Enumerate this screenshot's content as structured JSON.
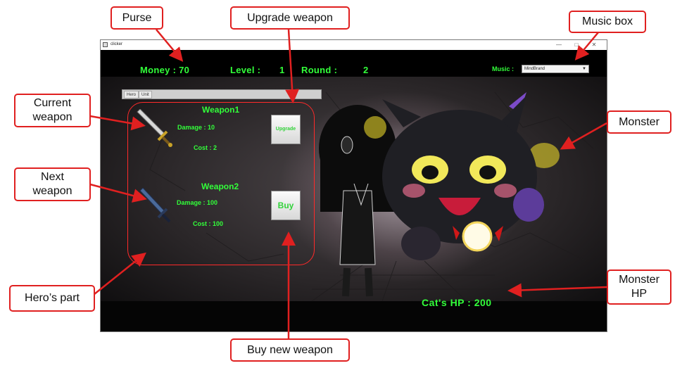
{
  "window": {
    "title": "clicker",
    "controls": {
      "minimize": "—",
      "maximize": "□",
      "close": "✕"
    }
  },
  "hud": {
    "money": "Money : 70",
    "level_label": "Level :",
    "level_value": "1",
    "round_label": "Round :",
    "round_value": "2",
    "music_label": "Music :",
    "music_selected": "MindBrand"
  },
  "tabs": [
    "Hero",
    "Unit"
  ],
  "weapons": {
    "current": {
      "name": "Weapon1",
      "damage": "Damage : 10",
      "cost": "Cost : 2",
      "button": "Upgrade"
    },
    "next": {
      "name": "Weapon2",
      "damage": "Damage : 100",
      "cost": "Cost : 100",
      "button": "Buy"
    }
  },
  "monster": {
    "hp_text": "Cat's  HP  :  200"
  },
  "annotations": {
    "purse": "Purse",
    "upgrade_weapon": "Upgrade weapon",
    "music_box": "Music box",
    "current_weapon": "Current\nweapon",
    "monster": "Monster",
    "next_weapon": "Next\nweapon",
    "monster_hp": "Monster\nHP",
    "heros_part": "Hero’s part",
    "buy_new_weapon": "Buy new weapon"
  },
  "icons": [
    "sword-icon",
    "dark-sword-icon",
    "cat-monster",
    "gothic-girl"
  ],
  "colors": {
    "hud_green": "#32ff3a",
    "callout_red": "#e02020",
    "background": "#000000"
  }
}
